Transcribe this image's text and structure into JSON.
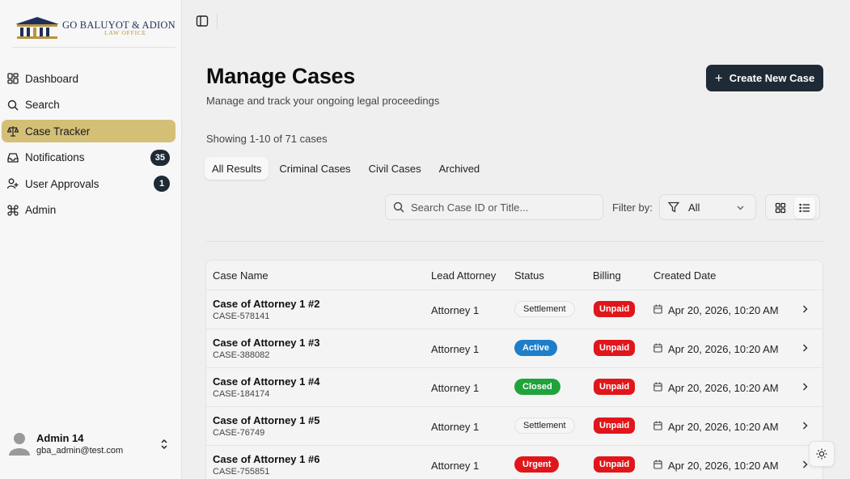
{
  "brand": {
    "title": "GO BALUYOT & ADION",
    "subtitle": "LAW OFFICE",
    "navy": "#1f2f5c",
    "gold": "#b8953e"
  },
  "sidebar": {
    "items": [
      {
        "label": "Dashboard",
        "icon": "dashboard-icon"
      },
      {
        "label": "Search",
        "icon": "search-icon"
      },
      {
        "label": "Case Tracker",
        "icon": "scale-icon",
        "active": true
      },
      {
        "label": "Notifications",
        "icon": "inbox-icon",
        "badge": "35"
      },
      {
        "label": "User Approvals",
        "icon": "user-plus-icon",
        "badge": "1"
      },
      {
        "label": "Admin",
        "icon": "command-icon"
      }
    ],
    "active_color": "#d4bf77"
  },
  "user": {
    "name": "Admin 14",
    "email": "gba_admin@test.com"
  },
  "header": {
    "title": "Manage Cases",
    "subtitle": "Manage and track your ongoing legal proceedings",
    "create_label": "Create New Case"
  },
  "showing": "Showing 1-10 of 71 cases",
  "tabs": [
    {
      "label": "All Results",
      "active": true
    },
    {
      "label": "Criminal Cases"
    },
    {
      "label": "Civil Cases"
    },
    {
      "label": "Archived"
    }
  ],
  "search": {
    "placeholder": "Search Case ID or Title..."
  },
  "filter": {
    "label": "Filter by:",
    "value": "All"
  },
  "table": {
    "columns": [
      "Case Name",
      "Lead Attorney",
      "Status",
      "Billing",
      "Created Date"
    ],
    "rows": [
      {
        "name": "Case of Attorney 1 #2",
        "id": "CASE-578141",
        "attorney": "Attorney 1",
        "status": "Settlement",
        "billing": "Unpaid",
        "date": "Apr 20, 2026, 10:20 AM"
      },
      {
        "name": "Case of Attorney 1 #3",
        "id": "CASE-388082",
        "attorney": "Attorney 1",
        "status": "Active",
        "billing": "Unpaid",
        "date": "Apr 20, 2026, 10:20 AM"
      },
      {
        "name": "Case of Attorney 1 #4",
        "id": "CASE-184174",
        "attorney": "Attorney 1",
        "status": "Closed",
        "billing": "Unpaid",
        "date": "Apr 20, 2026, 10:20 AM"
      },
      {
        "name": "Case of Attorney 1 #5",
        "id": "CASE-76749",
        "attorney": "Attorney 1",
        "status": "Settlement",
        "billing": "Unpaid",
        "date": "Apr 20, 2026, 10:20 AM"
      },
      {
        "name": "Case of Attorney 1 #6",
        "id": "CASE-755851",
        "attorney": "Attorney 1",
        "status": "Urgent",
        "billing": "Unpaid",
        "date": "Apr 20, 2026, 10:20 AM"
      }
    ]
  },
  "colors": {
    "primary": "#1e2a36",
    "active": "#1e7ec9",
    "closed": "#1fa33a",
    "urgent": "#e0161b"
  }
}
